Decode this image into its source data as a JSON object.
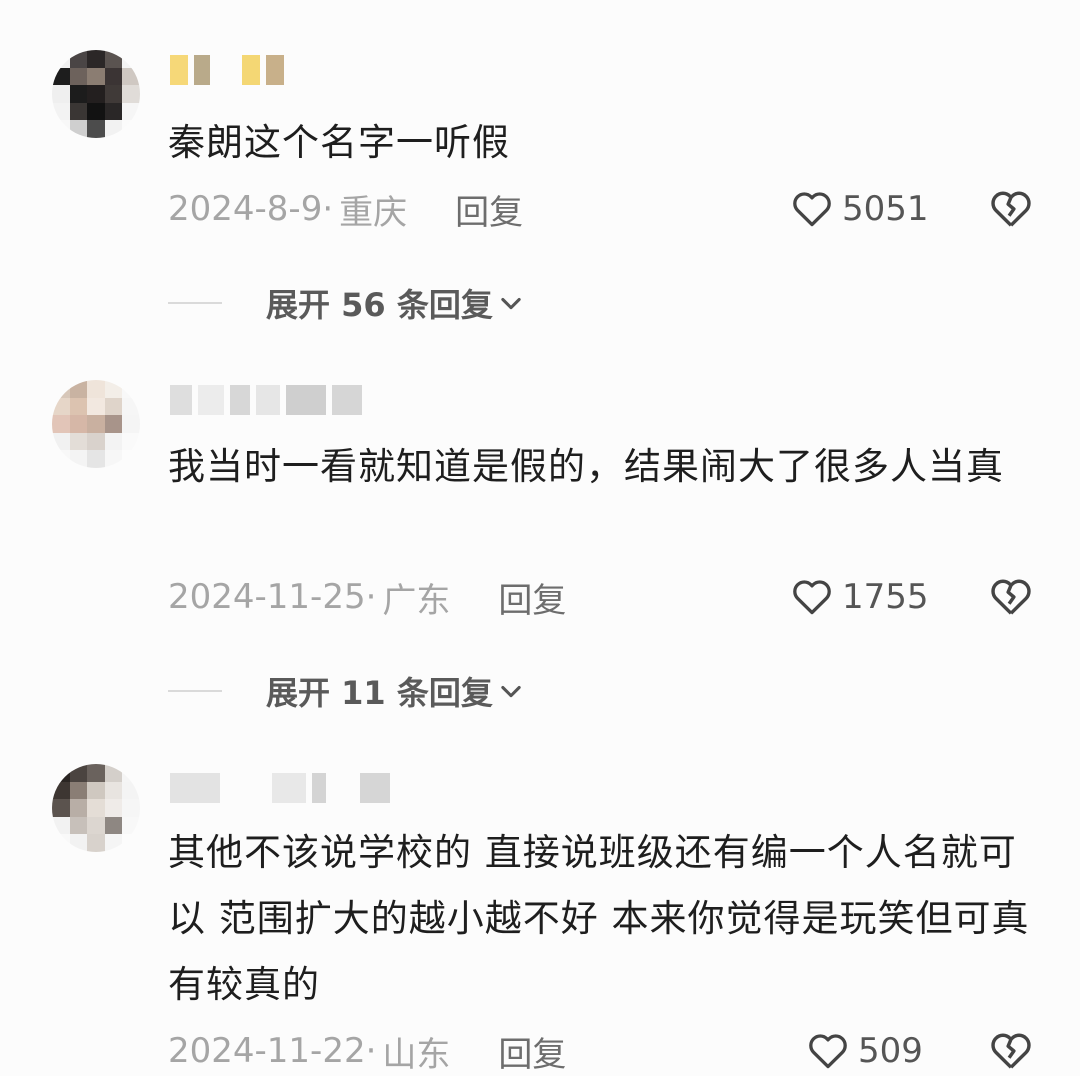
{
  "comments": [
    {
      "text": "秦朗这个名字一听假",
      "date": "2024-8-9·",
      "location": "重庆",
      "reply_label": "回复",
      "likes": "5051",
      "expand_label": "展开 56 条回复"
    },
    {
      "text": "我当时一看就知道是假的，结果闹大了很多人当真",
      "date": "2024-11-25·",
      "location": "广东",
      "reply_label": "回复",
      "likes": "1755",
      "expand_label": "展开 11 条回复"
    },
    {
      "text": "其他不该说学校的 直接说班级还有编一个人名就可以 范围扩大的越小越不好 本来你觉得是玩笑但可真有较真的",
      "date": "2024-11-22·",
      "location": "山东",
      "reply_label": "回复",
      "likes": "509"
    }
  ],
  "icons": {
    "like": "heart-outline-icon",
    "dislike": "broken-heart-icon",
    "expand": "chevron-down-icon"
  },
  "colors": {
    "background": "#fcfcfc",
    "meta_gray": "#a5a5a5",
    "text": "#1e1e1e"
  }
}
